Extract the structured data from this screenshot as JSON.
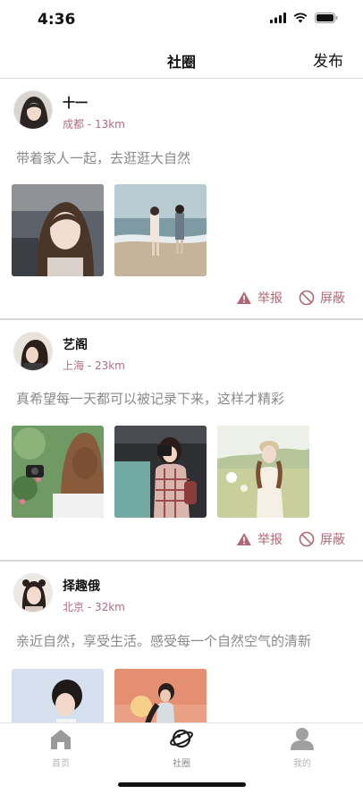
{
  "status_bar": {
    "time": "4:36"
  },
  "navbar": {
    "title": "社圈",
    "publish_label": "发布"
  },
  "posts": [
    {
      "username": "十一",
      "location": "成都 - 13km",
      "text": "带着家人一起，去逛逛大自然",
      "images": [
        "selfie-in-car",
        "beach-couple"
      ],
      "report_label": "举报",
      "block_label": "屏蔽"
    },
    {
      "username": "艺阁",
      "location": "上海 - 23km",
      "text": "真希望每一天都可以被记录下来，这样才精彩",
      "images": [
        "girl-with-camera",
        "girl-camera-plaid",
        "girl-in-field"
      ],
      "report_label": "举报",
      "block_label": "屏蔽"
    },
    {
      "username": "择趣俄",
      "location": "北京 - 32km",
      "text": "亲近自然，享受生活。感受每一个自然空气的清新",
      "images": [
        "boy-portrait",
        "girl-at-sunset"
      ]
    }
  ],
  "tabbar": {
    "items": [
      {
        "label": "首页",
        "icon": "home-icon"
      },
      {
        "label": "社圈",
        "icon": "planet-icon",
        "active": true
      },
      {
        "label": "我的",
        "icon": "person-icon"
      }
    ]
  },
  "colors": {
    "accent": "#b06878",
    "location": "#b56a7e",
    "muted_text": "#8a8a8a"
  }
}
